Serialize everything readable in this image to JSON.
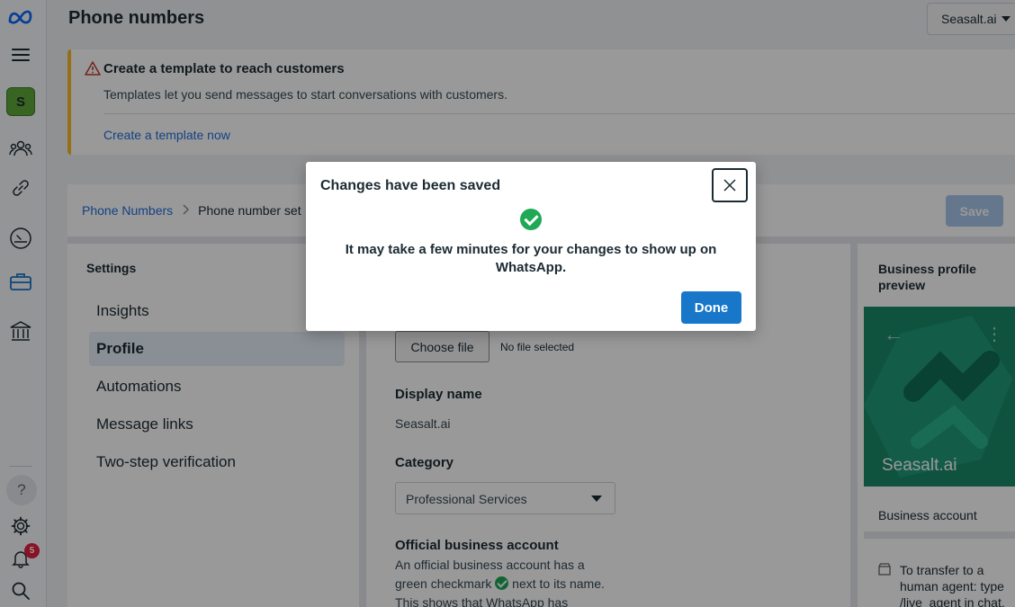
{
  "header": {
    "title": "Phone numbers",
    "account": "Seasalt.ai"
  },
  "rail": {
    "workspace_initial": "S",
    "help_glyph": "?",
    "notification_count": "5"
  },
  "banner": {
    "title": "Create a template to reach customers",
    "text": "Templates let you send messages to start conversations with customers.",
    "link": "Create a template now"
  },
  "breadcrumb": {
    "parent": "Phone Numbers",
    "current": "Phone number set"
  },
  "toolbar": {
    "save_label": "Save"
  },
  "settings": {
    "title": "Settings",
    "items": [
      {
        "label": "Insights"
      },
      {
        "label": "Profile"
      },
      {
        "label": "Automations"
      },
      {
        "label": "Message links"
      },
      {
        "label": "Two-step verification"
      }
    ],
    "active_index": 1
  },
  "profile": {
    "choose_file_label": "Choose file",
    "no_file_text": "No file selected",
    "display_name_label": "Display name",
    "display_name_value": "Seasalt.ai",
    "category_label": "Category",
    "category_value": "Professional Services",
    "oba_label": "Official business account",
    "oba_text_1": "An official business account has a green checkmark",
    "oba_text_2": "next to its name. This shows that WhatsApp has"
  },
  "preview": {
    "title": "Business profile preview",
    "name": "Seasalt.ai",
    "account_type": "Business account",
    "about": "To transfer to a human agent: type /live_agent in chat."
  },
  "modal": {
    "title": "Changes have been saved",
    "message": "It may take a few minutes for your changes to show up on WhatsApp.",
    "done_label": "Done"
  },
  "colors": {
    "accent": "#1877c9",
    "link": "#216fdb",
    "success": "#1fa855",
    "warning": "#f7b928",
    "badge": "#e41e3f"
  }
}
